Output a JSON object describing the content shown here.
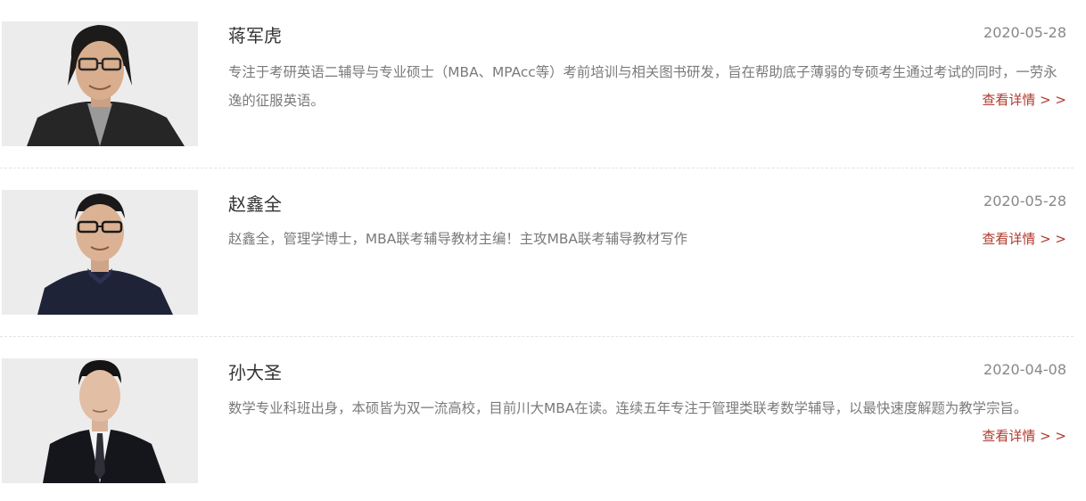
{
  "teachers": [
    {
      "name": "蒋军虎",
      "date": "2020-05-28",
      "description": "专注于考研英语二辅导与专业硕士（MBA、MPAcc等）考前培训与相关图书研发，旨在帮助底子薄弱的专硕考生通过考试的同时，一劳永逸的征服英语。",
      "more": "查看详情 > >"
    },
    {
      "name": "赵鑫全",
      "date": "2020-05-28",
      "description": "赵鑫全，管理学博士，MBA联考辅导教材主编！主攻MBA联考辅导教材写作",
      "more": "查看详情 > >"
    },
    {
      "name": "孙大圣",
      "date": "2020-04-08",
      "description": "数学专业科班出身，本硕皆为双一流高校，目前川大MBA在读。连续五年专注于管理类联考数学辅导，以最快速度解题为教学宗旨。",
      "more": "查看详情 > >"
    }
  ]
}
